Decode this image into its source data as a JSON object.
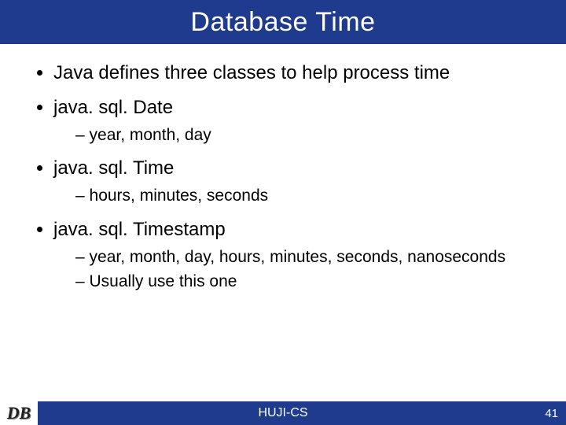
{
  "title": "Database Time",
  "bullets": {
    "intro": "Java defines three classes to help process time",
    "date": {
      "name": "java. sql. Date",
      "desc": "year, month, day"
    },
    "time": {
      "name": "java. sql. Time",
      "desc": "hours, minutes, seconds"
    },
    "timestamp": {
      "name": "java. sql. Timestamp",
      "desc1": "year, month, day, hours, minutes, seconds, nanoseconds",
      "desc2": "Usually use this one"
    }
  },
  "footer": {
    "left": "DB",
    "center": "HUJI-CS",
    "page": "41"
  }
}
